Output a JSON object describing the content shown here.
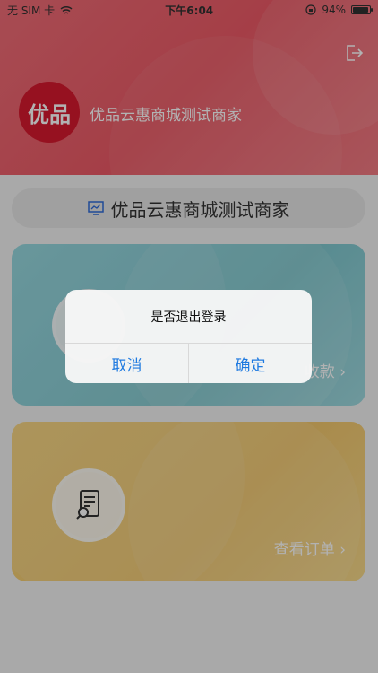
{
  "status_bar": {
    "carrier": "无 SIM 卡",
    "time": "下午6:04",
    "battery": "94%",
    "battery_level": 0.94
  },
  "header": {
    "logo_text": "优品",
    "shop_name": "优品云惠商城测试商家"
  },
  "merchant": {
    "name": "优品云惠商城测试商家"
  },
  "cards": {
    "payment": {
      "link": "收款"
    },
    "orders": {
      "link": "查看订单"
    }
  },
  "dialog": {
    "message": "是否退出登录",
    "cancel": "取消",
    "confirm": "确定"
  },
  "colors": {
    "header": "#ec5a66",
    "logo": "#d7192f",
    "payment_card": "#7fc8cf",
    "orders_card": "#f3c86d",
    "dialog_button": "#1f7ae0"
  },
  "icons": [
    "wifi-icon",
    "lock-rotation-icon",
    "battery-icon",
    "logout-icon",
    "monitor-chart-icon",
    "receipt-search-icon",
    "chevron-right-icon"
  ]
}
